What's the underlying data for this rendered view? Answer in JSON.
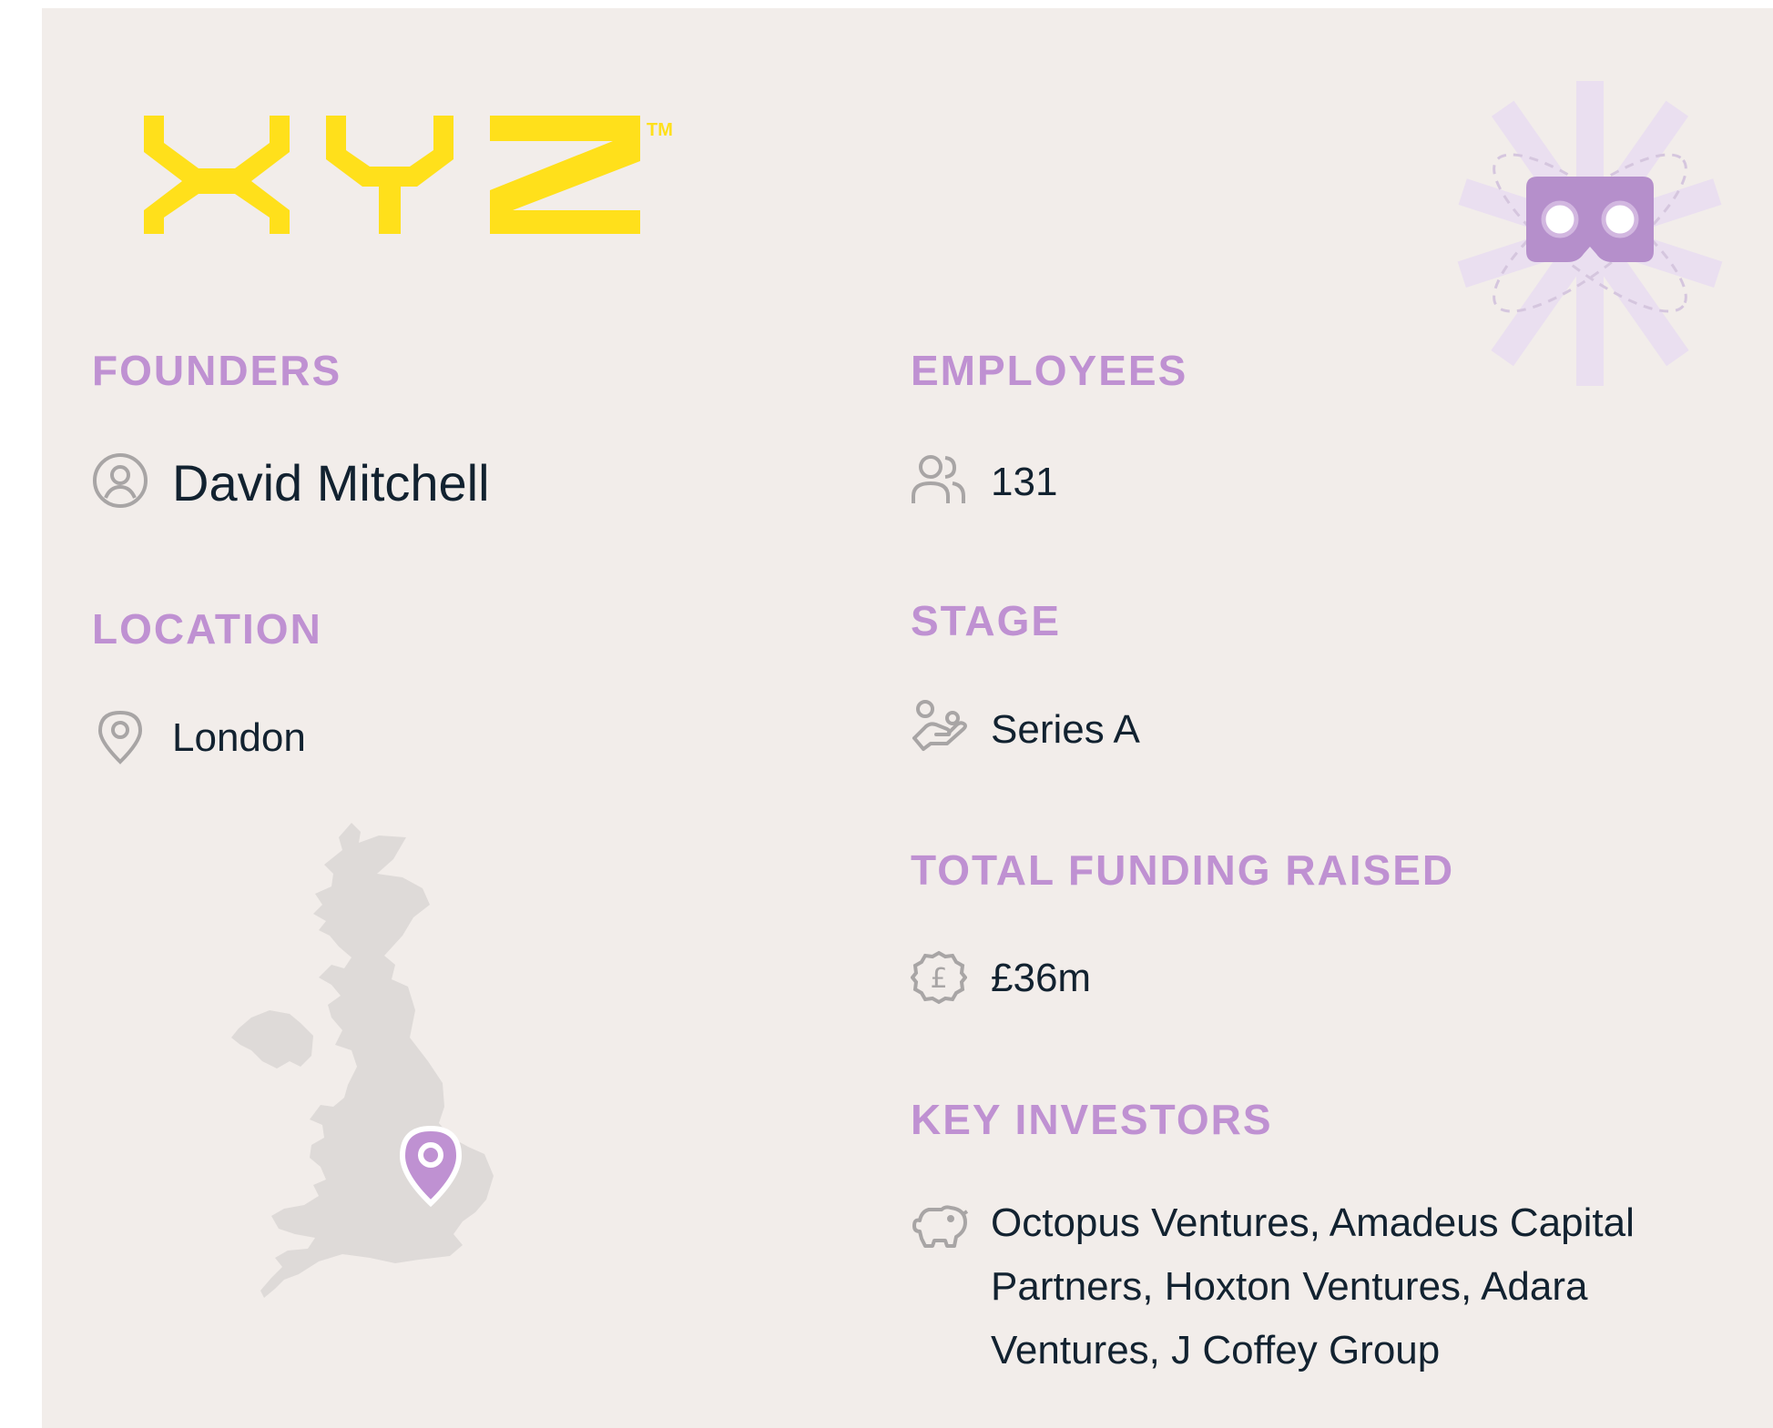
{
  "brand": {
    "logo_text": "XYZ",
    "trademark": "TM",
    "logo_color": "#ffe01b",
    "accent_color": "#bf91d2"
  },
  "founders": {
    "heading": "FOUNDERS",
    "name": "David Mitchell",
    "icon": "user-circle-icon"
  },
  "employees": {
    "heading": "EMPLOYEES",
    "count": "131",
    "icon": "users-icon"
  },
  "location": {
    "heading": "LOCATION",
    "city": "London",
    "icon": "map-pin-icon",
    "map": "uk-map",
    "map_pin": "map-pin-marker-icon"
  },
  "stage": {
    "heading": "STAGE",
    "value": "Series A",
    "icon": "hand-coin-icon"
  },
  "funding": {
    "heading": "TOTAL FUNDING RAISED",
    "value": "£36m",
    "icon": "pound-badge-icon"
  },
  "investors": {
    "heading": "KEY INVESTORS",
    "value": "Octopus Ventures, Amadeus Capital Partners, Hoxton Ventures, Adara Ventures, J Coffey Group",
    "icon": "piggy-bank-icon"
  },
  "decoration": {
    "icon": "vr-headset-icon"
  }
}
